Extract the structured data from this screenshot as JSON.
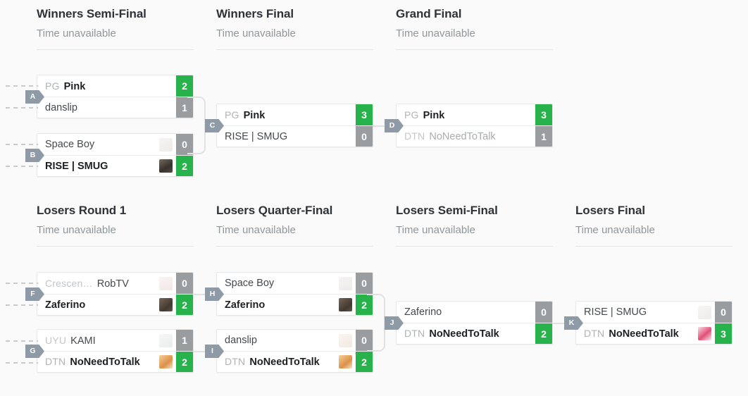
{
  "page": {
    "background": "#fafafa",
    "time_unavailable": "Time unavailable",
    "accent_win": "#27b24b",
    "accent_lose": "#9a9d9f",
    "badge_color": "#8e9aa5"
  },
  "rounds": [
    {
      "id": "winners-semi-final",
      "title": "Winners Semi-Final",
      "time": "Time unavailable"
    },
    {
      "id": "winners-final",
      "title": "Winners Final",
      "time": "Time unavailable"
    },
    {
      "id": "grand-final",
      "title": "Grand Final",
      "time": "Time unavailable"
    },
    {
      "id": "losers-round-1",
      "title": "Losers Round 1",
      "time": "Time unavailable"
    },
    {
      "id": "losers-quarter-final",
      "title": "Losers Quarter-Final",
      "time": "Time unavailable"
    },
    {
      "id": "losers-semi-final",
      "title": "Losers Semi-Final",
      "time": "Time unavailable"
    },
    {
      "id": "losers-final",
      "title": "Losers Final",
      "time": "Time unavailable"
    }
  ],
  "matches": [
    {
      "letter": "A",
      "round": "winners-semi-final",
      "slots": [
        {
          "prefix": "PG",
          "name": "Pink",
          "score": "2",
          "result": "win",
          "avatar": "none"
        },
        {
          "prefix": "",
          "name": "danslip",
          "score": "1",
          "result": "lose",
          "avatar": "none"
        }
      ]
    },
    {
      "letter": "B",
      "round": "winners-semi-final",
      "slots": [
        {
          "prefix": "",
          "name": "Space Boy",
          "score": "0",
          "result": "lose",
          "avatar": "player-avatar-faint"
        },
        {
          "prefix": "",
          "name": "RISE | SMUG",
          "score": "2",
          "result": "win",
          "avatar": "player-avatar"
        }
      ]
    },
    {
      "letter": "C",
      "round": "winners-final",
      "slots": [
        {
          "prefix": "PG",
          "name": "Pink",
          "score": "3",
          "result": "win",
          "avatar": "none"
        },
        {
          "prefix": "",
          "name": "RISE | SMUG",
          "score": "0",
          "result": "lose",
          "avatar": "none"
        }
      ]
    },
    {
      "letter": "D",
      "round": "grand-final",
      "slots": [
        {
          "prefix": "PG",
          "name": "Pink",
          "score": "3",
          "result": "win",
          "avatar": "none"
        },
        {
          "prefix": "DTN",
          "name": "NoNeedToTalk",
          "score": "1",
          "result": "lose",
          "avatar": "none"
        }
      ]
    },
    {
      "letter": "F",
      "round": "losers-round-1",
      "slots": [
        {
          "prefix": "Crescen…",
          "name": "RobTV",
          "score": "0",
          "result": "lose",
          "avatar": "player-avatar-faint"
        },
        {
          "prefix": "",
          "name": "Zaferino",
          "score": "2",
          "result": "win",
          "avatar": "player-avatar"
        }
      ]
    },
    {
      "letter": "G",
      "round": "losers-round-1",
      "slots": [
        {
          "prefix": "UYU",
          "name": "KAMI",
          "score": "1",
          "result": "lose",
          "avatar": "player-avatar-faint"
        },
        {
          "prefix": "DTN",
          "name": "NoNeedToTalk",
          "score": "2",
          "result": "win",
          "avatar": "player-avatar"
        }
      ]
    },
    {
      "letter": "H",
      "round": "losers-quarter-final",
      "slots": [
        {
          "prefix": "",
          "name": "Space Boy",
          "score": "0",
          "result": "lose",
          "avatar": "player-avatar-faint"
        },
        {
          "prefix": "",
          "name": "Zaferino",
          "score": "2",
          "result": "win",
          "avatar": "player-avatar"
        }
      ]
    },
    {
      "letter": "I",
      "round": "losers-quarter-final",
      "slots": [
        {
          "prefix": "",
          "name": "danslip",
          "score": "0",
          "result": "lose",
          "avatar": "player-avatar-faint"
        },
        {
          "prefix": "DTN",
          "name": "NoNeedToTalk",
          "score": "2",
          "result": "win",
          "avatar": "player-avatar"
        }
      ]
    },
    {
      "letter": "J",
      "round": "losers-semi-final",
      "slots": [
        {
          "prefix": "",
          "name": "Zaferino",
          "score": "0",
          "result": "lose",
          "avatar": "none"
        },
        {
          "prefix": "DTN",
          "name": "NoNeedToTalk",
          "score": "2",
          "result": "win",
          "avatar": "none"
        }
      ]
    },
    {
      "letter": "K",
      "round": "losers-final",
      "slots": [
        {
          "prefix": "",
          "name": "RISE | SMUG",
          "score": "0",
          "result": "lose",
          "avatar": "player-avatar-faint"
        },
        {
          "prefix": "DTN",
          "name": "NoNeedToTalk",
          "score": "3",
          "result": "win",
          "avatar": "player-avatar"
        }
      ]
    }
  ]
}
